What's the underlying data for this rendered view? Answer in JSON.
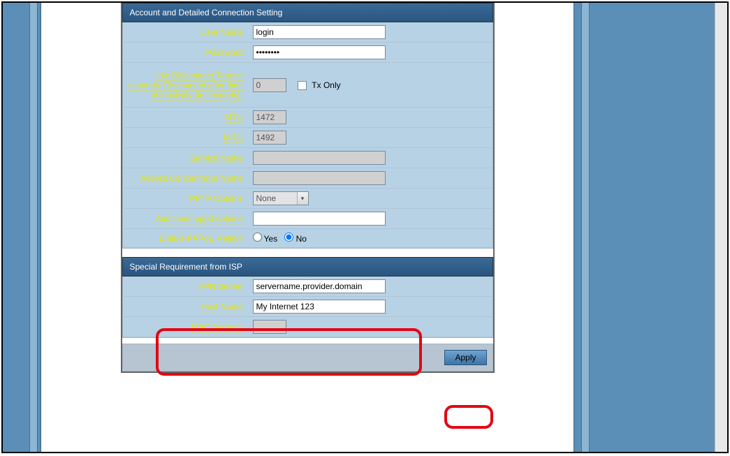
{
  "section1": {
    "title": "Account and Detailed Connection Setting",
    "user_name_label": "User Name",
    "user_name_value": "login",
    "password_label": "Password",
    "password_value": "••••••••",
    "idle_label": "Idle Disconnect Time in seconds: Disconnect after time of inactivity (in seconds):",
    "idle_value": "0",
    "tx_only_label": "Tx Only",
    "mtu_label": "MTU",
    "mtu_value": "1472",
    "mru_label": "MRU",
    "mru_value": "1492",
    "service_name_label": "Service Name",
    "service_name_value": "",
    "ac_name_label": "Access Concentrator Name",
    "ac_name_value": "",
    "pptp_options_label": "PPTP Options",
    "pptp_options_value": "None",
    "pppd_options_label": "Additional pppd options",
    "pppd_options_value": "",
    "pppoe_relay_label": "Enable PPPoE Relay?",
    "yes_label": "Yes",
    "no_label": "No"
  },
  "section2": {
    "title": "Special Requirement from ISP",
    "vpn_server_label": "VPN Server",
    "vpn_server_value": "servername.provider.domain",
    "host_name_label": "Host Name",
    "host_name_value": "My Internet 123",
    "mac_label": "MAC Address",
    "mac_value": ""
  },
  "buttons": {
    "apply_label": "Apply"
  }
}
